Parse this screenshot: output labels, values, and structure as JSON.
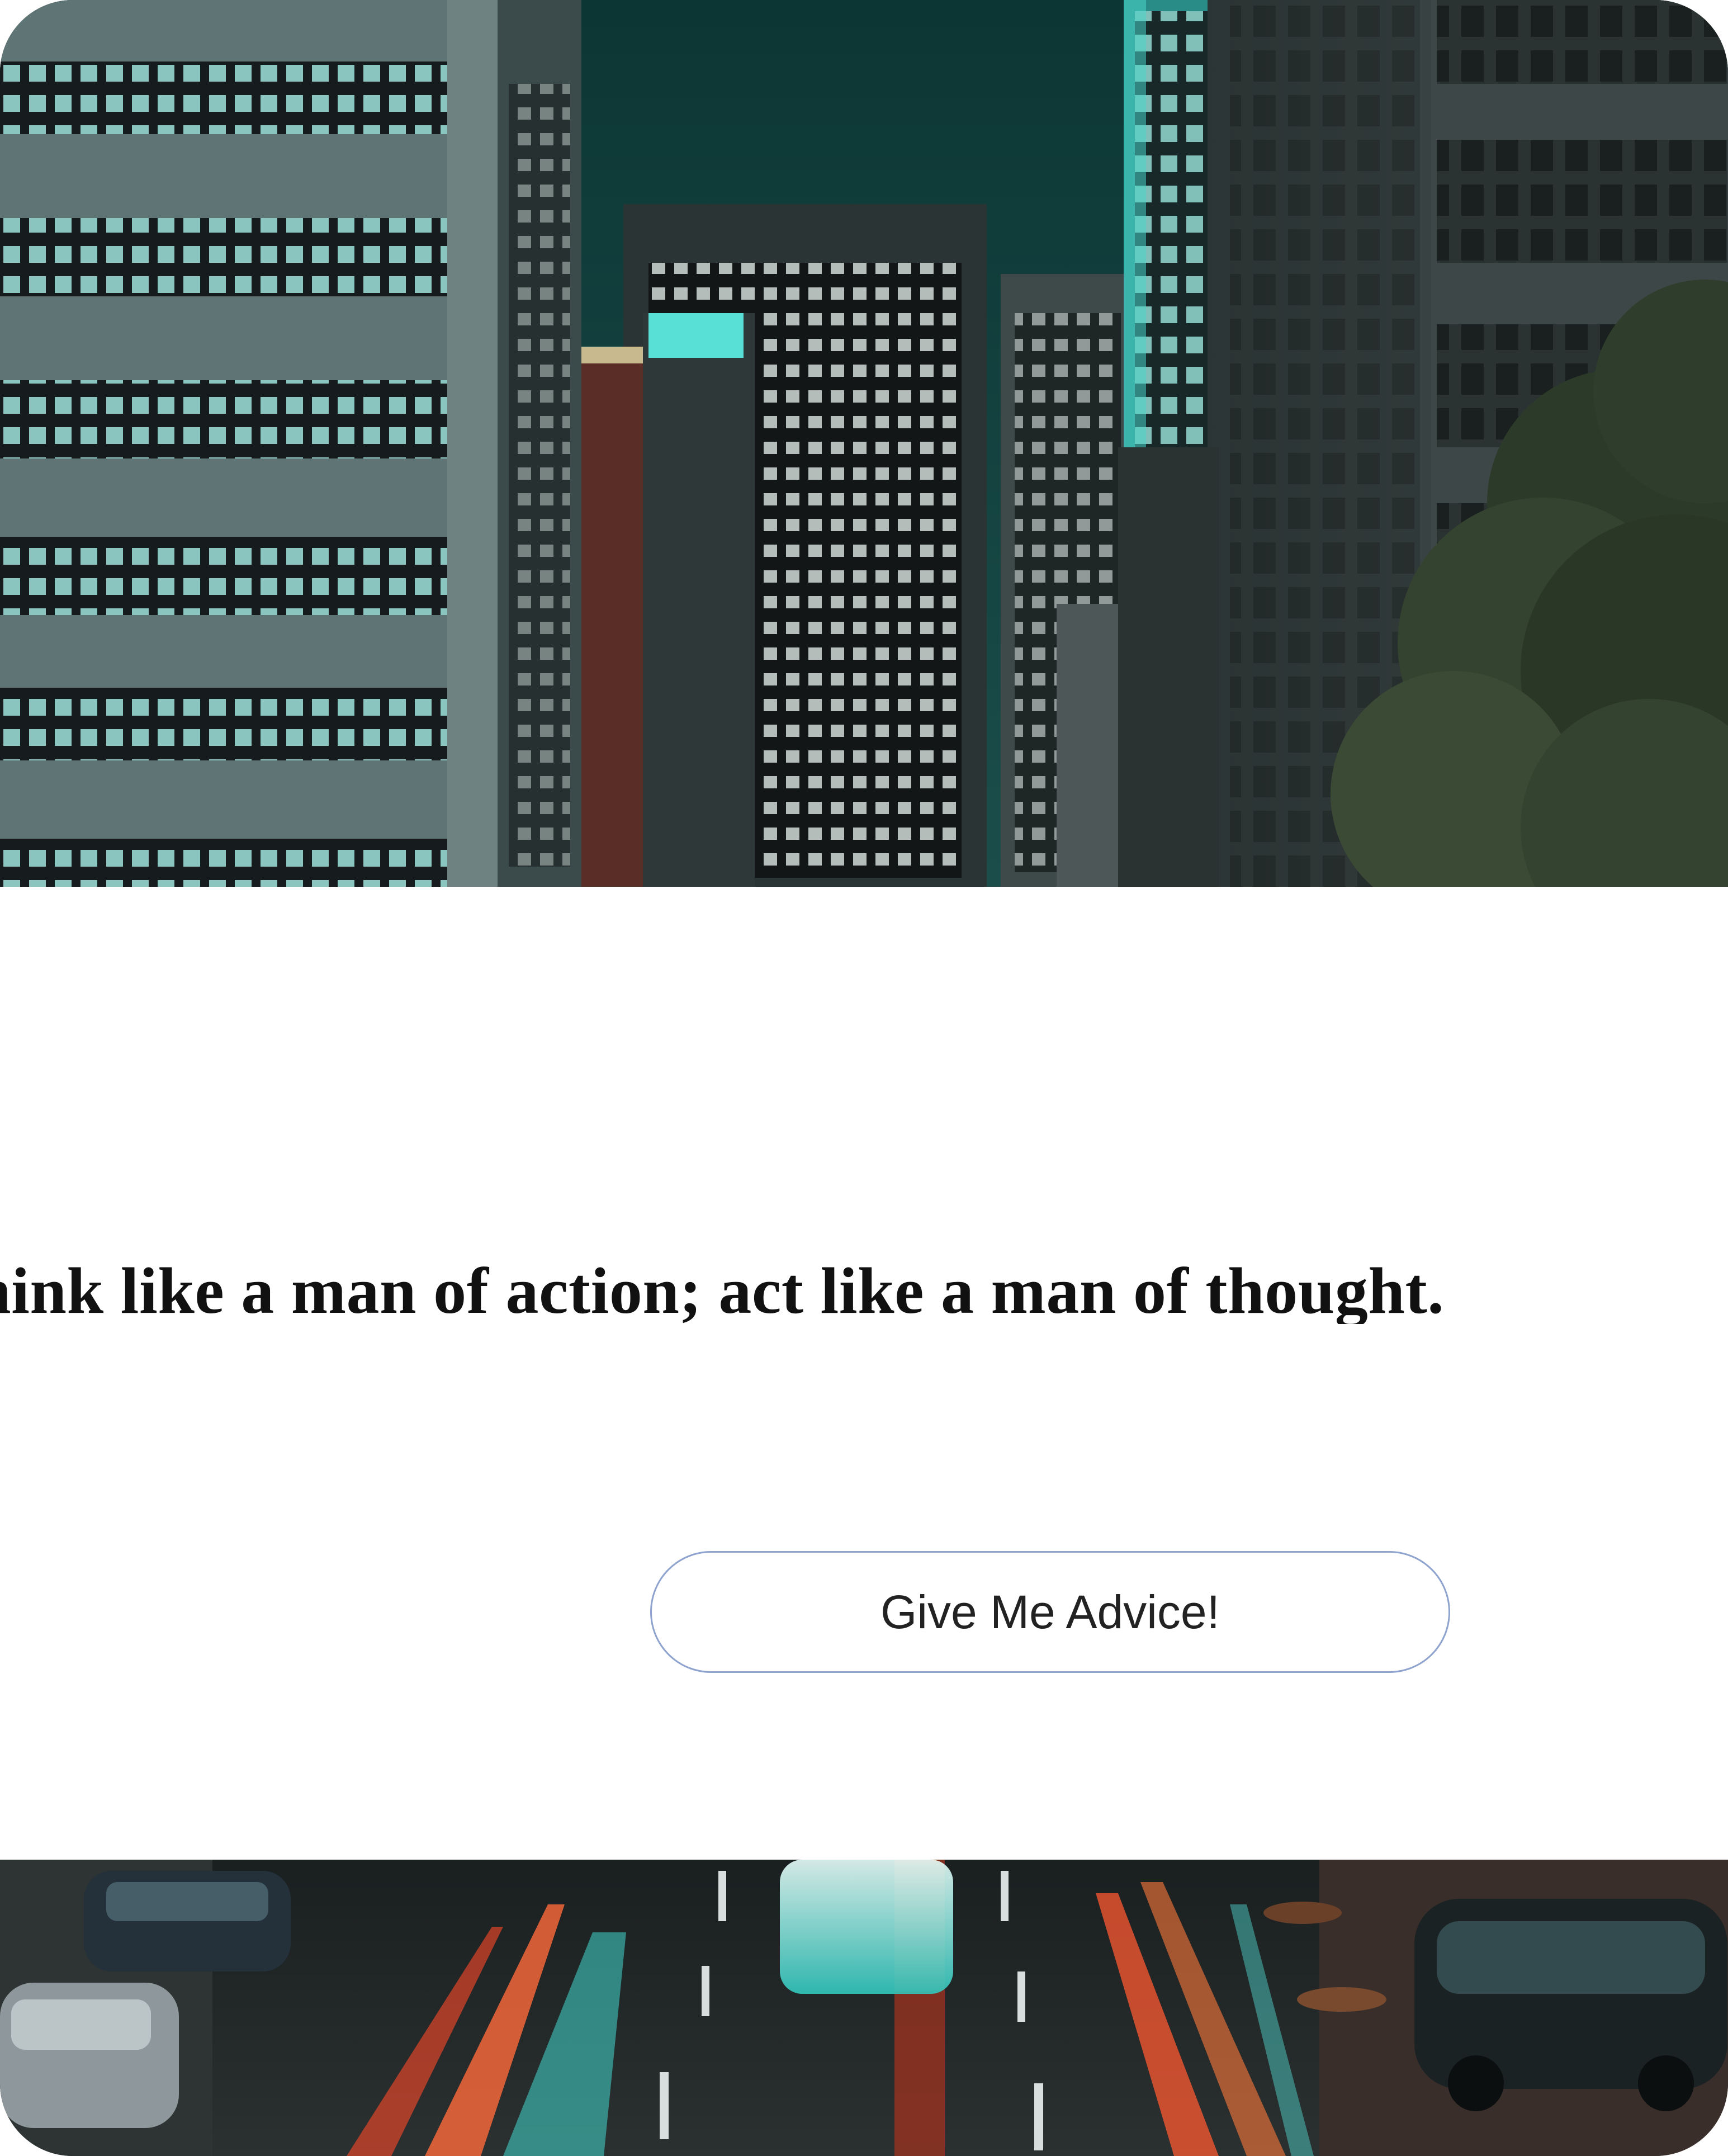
{
  "quote": {
    "text": "hink like a man of action; act like a man of thought."
  },
  "advice_button": {
    "label": "Give Me Advice!"
  },
  "colors": {
    "sky": "#0f3b3a",
    "teal_light": "#4fe0d6",
    "button_border": "#8fa3cf",
    "quote_text": "#111111"
  },
  "images": {
    "top": "city-skyscrapers-night-photo",
    "bottom": "traffic-light-trails-photo"
  }
}
